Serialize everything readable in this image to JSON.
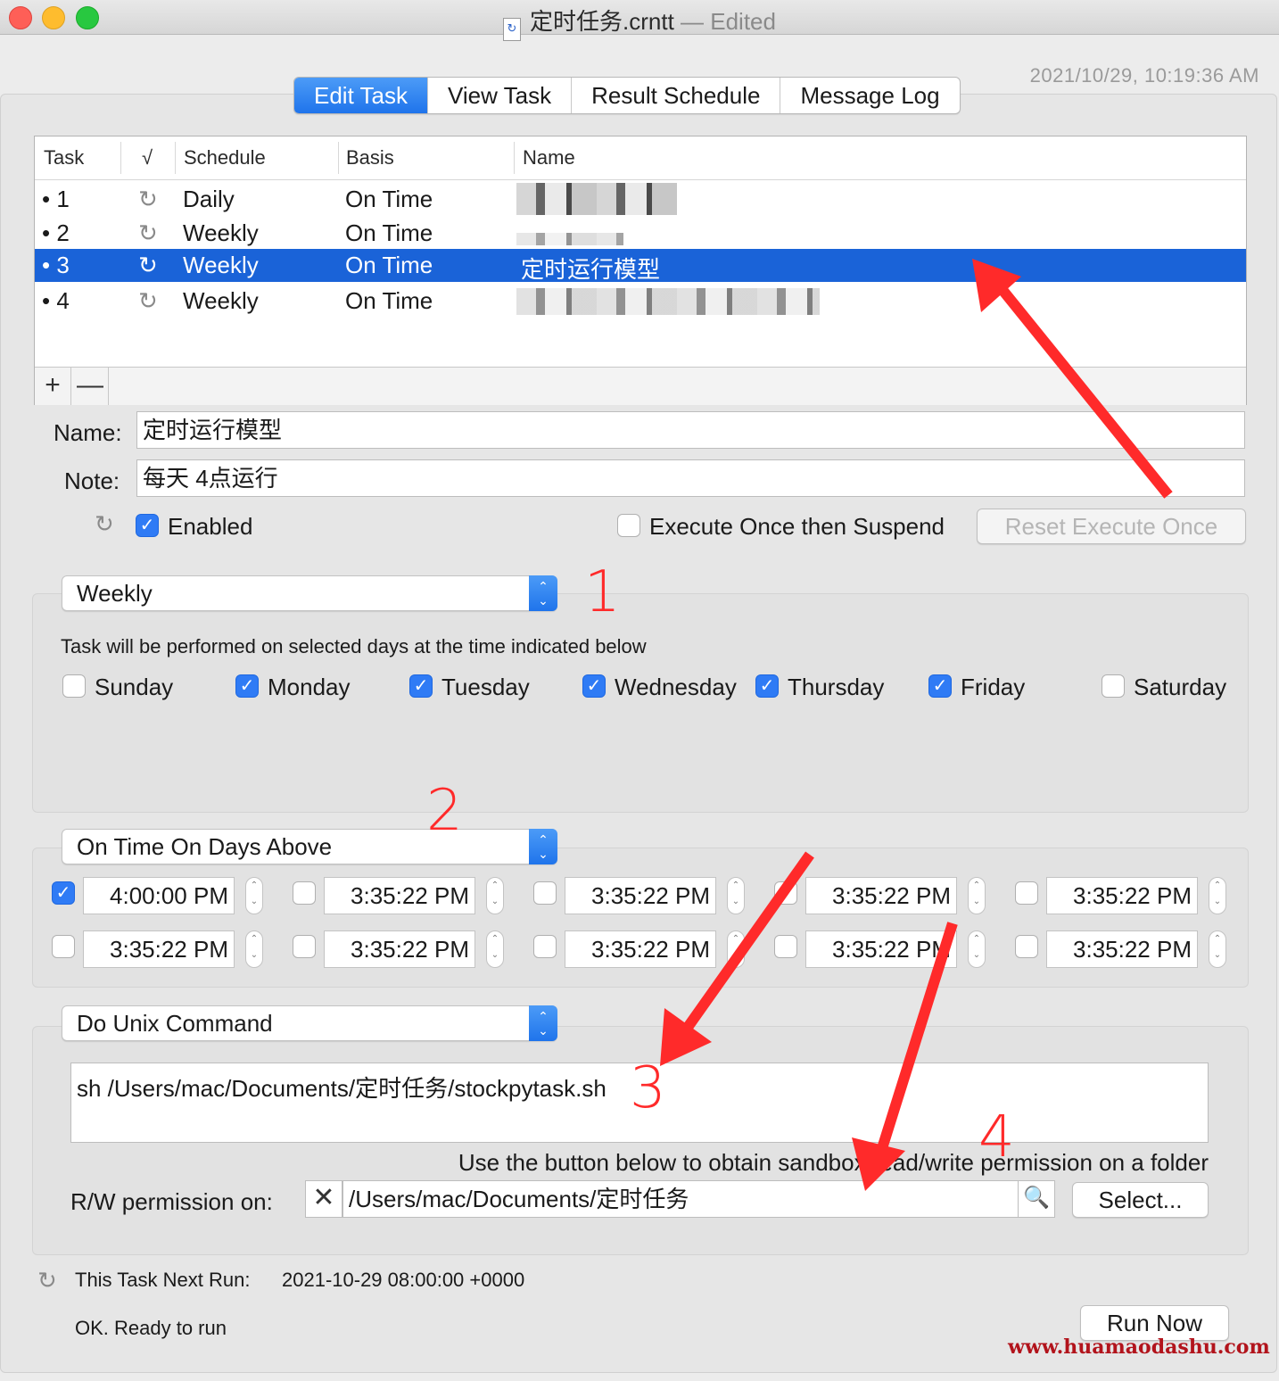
{
  "window": {
    "title": "定时任务.crntt",
    "edited": "— Edited",
    "timestamp": "2021/10/29, 10:19:36 AM"
  },
  "tabs": [
    "Edit Task",
    "View Task",
    "Result Schedule",
    "Message Log"
  ],
  "table": {
    "headers": {
      "task": "Task",
      "check": "√",
      "schedule": "Schedule",
      "basis": "Basis",
      "name": "Name"
    },
    "rows": [
      {
        "task": "• 1",
        "schedule": "Daily",
        "basis": "On Time",
        "name": ""
      },
      {
        "task": "• 2",
        "schedule": "Weekly",
        "basis": "On Time",
        "name": ""
      },
      {
        "task": "• 3",
        "schedule": "Weekly",
        "basis": "On Time",
        "name": "定时运行模型"
      },
      {
        "task": "• 4",
        "schedule": "Weekly",
        "basis": "On Time",
        "name": ""
      }
    ],
    "add": "+",
    "remove": "—"
  },
  "form": {
    "name_label": "Name:",
    "name_value": "定时运行模型",
    "note_label": "Note:",
    "note_value": "每天 4点运行",
    "enabled_label": "Enabled",
    "execute_once_label": "Execute Once then Suspend",
    "reset_label": "Reset Execute Once"
  },
  "schedule": {
    "popup": "Weekly",
    "description": "Task will be performed on selected days at the time indicated below",
    "days": [
      {
        "label": "Sunday",
        "checked": false
      },
      {
        "label": "Monday",
        "checked": true
      },
      {
        "label": "Tuesday",
        "checked": true
      },
      {
        "label": "Wednesday",
        "checked": true
      },
      {
        "label": "Thursday",
        "checked": true
      },
      {
        "label": "Friday",
        "checked": true
      },
      {
        "label": "Saturday",
        "checked": false
      }
    ]
  },
  "timing": {
    "popup": "On Time On Days Above",
    "times": [
      "4:00:00 PM",
      "3:35:22 PM",
      "3:35:22 PM",
      "3:35:22 PM",
      "3:35:22 PM",
      "3:35:22 PM",
      "3:35:22 PM",
      "3:35:22 PM",
      "3:35:22 PM",
      "3:35:22 PM"
    ],
    "checked": [
      true,
      false,
      false,
      false,
      false,
      false,
      false,
      false,
      false,
      false
    ]
  },
  "action": {
    "popup": "Do Unix Command",
    "command": "sh  /Users/mac/Documents/定时任务/stockpytask.sh",
    "sandbox_note": "Use the button below to obtain sandbox read/write permission on a folder",
    "rw_label": "R/W permission on:",
    "rw_path": "/Users/mac/Documents/定时任务",
    "select_label": "Select..."
  },
  "status": {
    "next_run_label": "This Task Next Run:",
    "next_run_value": "2021-10-29 08:00:00 +0000",
    "message": "OK. Ready to run",
    "run_now": "Run Now"
  },
  "annotations": [
    "1",
    "2",
    "3",
    "4"
  ],
  "watermark": "www.huamaodashu.com",
  "colors": {
    "accent": "#1f74eb",
    "selection": "#1a63d8",
    "annotation": "#ff2a2a",
    "watermark": "#b2141c"
  }
}
